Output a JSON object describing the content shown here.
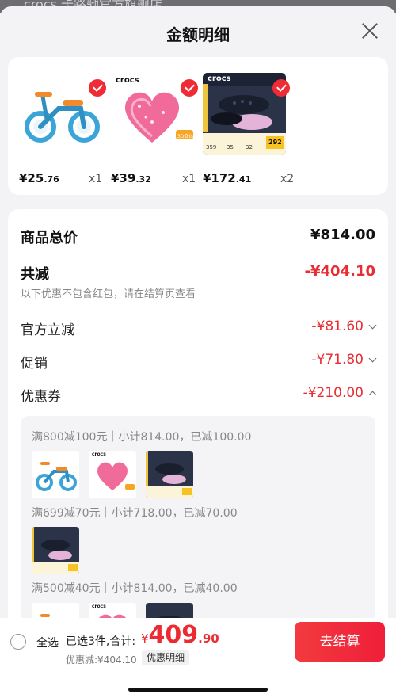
{
  "background_strip_text": "crocs 卡路驰官方旗舰店",
  "header": {
    "title": "金额明细"
  },
  "products": [
    {
      "price_int": "¥25",
      "price_dec": ".76",
      "qty": "x1",
      "image": "balance-bike"
    },
    {
      "price_int": "¥39",
      "price_dec": ".32",
      "qty": "x1",
      "image": "pink-heart-charm",
      "brand": "crocs",
      "badge": "3D立体"
    },
    {
      "price_int": "¥172",
      "price_dec": ".41",
      "qty": "x2",
      "image": "crocs-clog-bundle",
      "brand": "crocs",
      "ad_numbers": [
        "359",
        "35",
        "32",
        "292"
      ]
    }
  ],
  "summary": {
    "total_label": "商品总价",
    "total_value": "¥814.00",
    "reduce_label": "共减",
    "reduce_value": "-¥404.10",
    "note": "以下优惠不包含红包，请在结算页查看",
    "official_label": "官方立减",
    "official_value": "-¥81.60",
    "promo_label": "促销",
    "promo_value": "-¥71.80",
    "coupon_label": "优惠券",
    "coupon_value": "-¥210.00"
  },
  "coupons": [
    {
      "text": "满800减100元｜小计814.00，已减100.00"
    },
    {
      "text": "满699减70元｜小计718.00，已减70.00"
    },
    {
      "text": "满500减40元｜小计814.00，已减40.00"
    }
  ],
  "footer": {
    "select_all": "全选",
    "selected_text": "已选3件,合计:",
    "total_symbol": "¥",
    "total_int": "409",
    "total_dec": ".90",
    "discount_text": "优惠减:¥404.10",
    "detail_button": "优惠明细",
    "checkout_button": "去结算"
  },
  "colors": {
    "accent_red": "#ea2c32",
    "checkout_red": "#f0243a",
    "check_red": "#ef2b36"
  }
}
